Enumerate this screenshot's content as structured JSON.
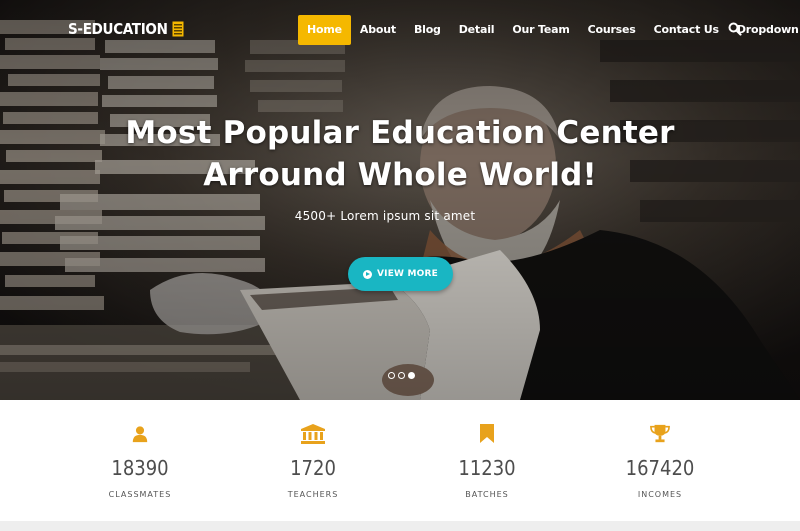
{
  "brand": {
    "name": "S-EDUCATION",
    "logo_icon": "book-icon"
  },
  "nav": {
    "items": [
      {
        "label": "Home",
        "active": true
      },
      {
        "label": "About"
      },
      {
        "label": "Blog"
      },
      {
        "label": "Detail"
      },
      {
        "label": "Our Team"
      },
      {
        "label": "Courses"
      },
      {
        "label": "Contact Us"
      },
      {
        "label": "Dropdown",
        "has_caret": true
      }
    ],
    "search_icon": "search-icon",
    "active_color": "#f5b800"
  },
  "hero": {
    "title_line1": "Most Popular Education Center",
    "title_line2": "Arround Whole World!",
    "subtitle": "4500+ Lorem ipsum sit amet",
    "button_label": "VIEW MORE",
    "button_color": "#19b6c3",
    "slides": 3,
    "active_slide": 3
  },
  "stats": [
    {
      "icon": "user-icon",
      "value": "18390",
      "label": "CLASSMATES"
    },
    {
      "icon": "bank-icon",
      "value": "1720",
      "label": "TEACHERS"
    },
    {
      "icon": "bookmark-icon",
      "value": "11230",
      "label": "BATCHES"
    },
    {
      "icon": "trophy-icon",
      "value": "167420",
      "label": "INCOMES"
    }
  ],
  "accent_color": "#e8a21c"
}
